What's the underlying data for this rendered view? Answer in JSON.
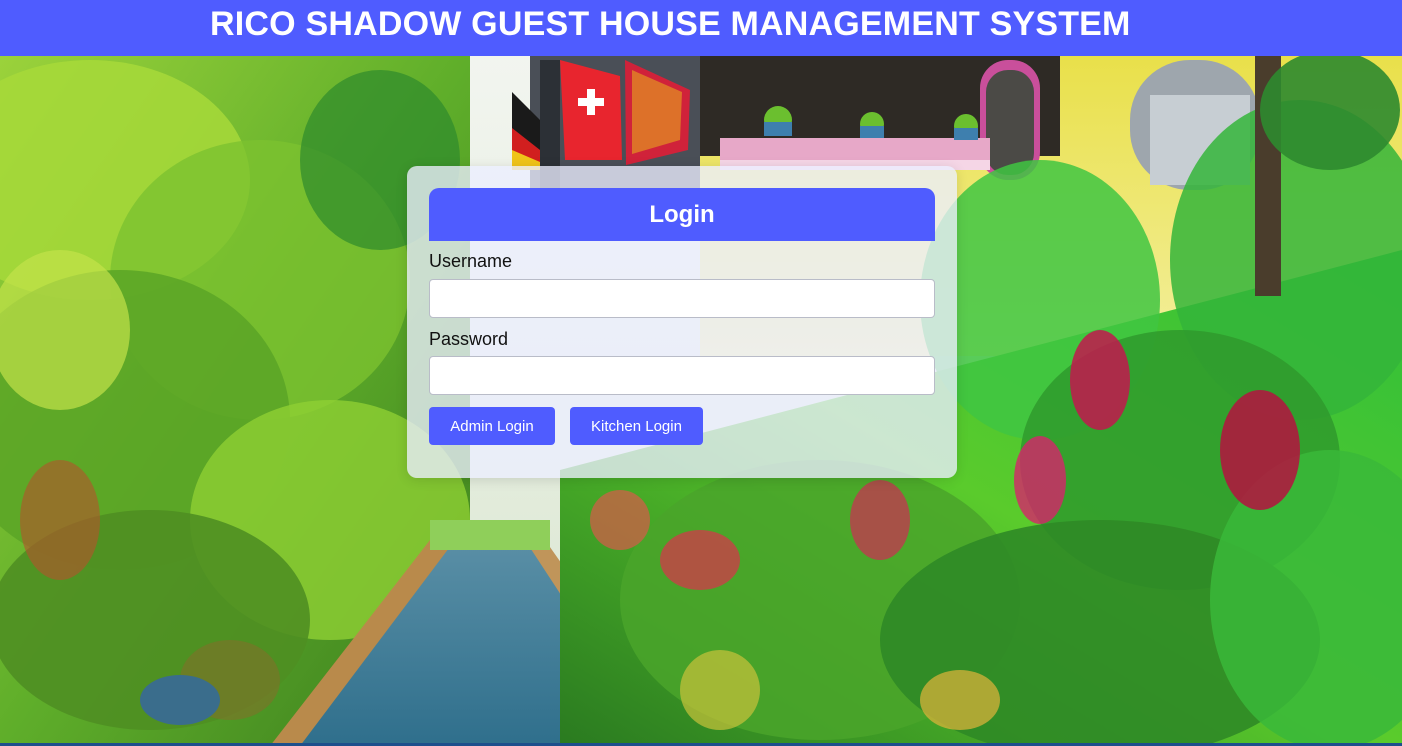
{
  "header": {
    "title": "RICO SHADOW GUEST HOUSE MANAGEMENT SYSTEM"
  },
  "login": {
    "title": "Login",
    "username_label": "Username",
    "username_value": "",
    "password_label": "Password",
    "password_value": "",
    "admin_button": "Admin Login",
    "kitchen_button": "Kitchen Login"
  },
  "colors": {
    "accent": "#4f5cff",
    "card_bg": "#eceeff",
    "text": "#111111"
  },
  "background": {
    "scene": "garden-pathway-photo"
  }
}
